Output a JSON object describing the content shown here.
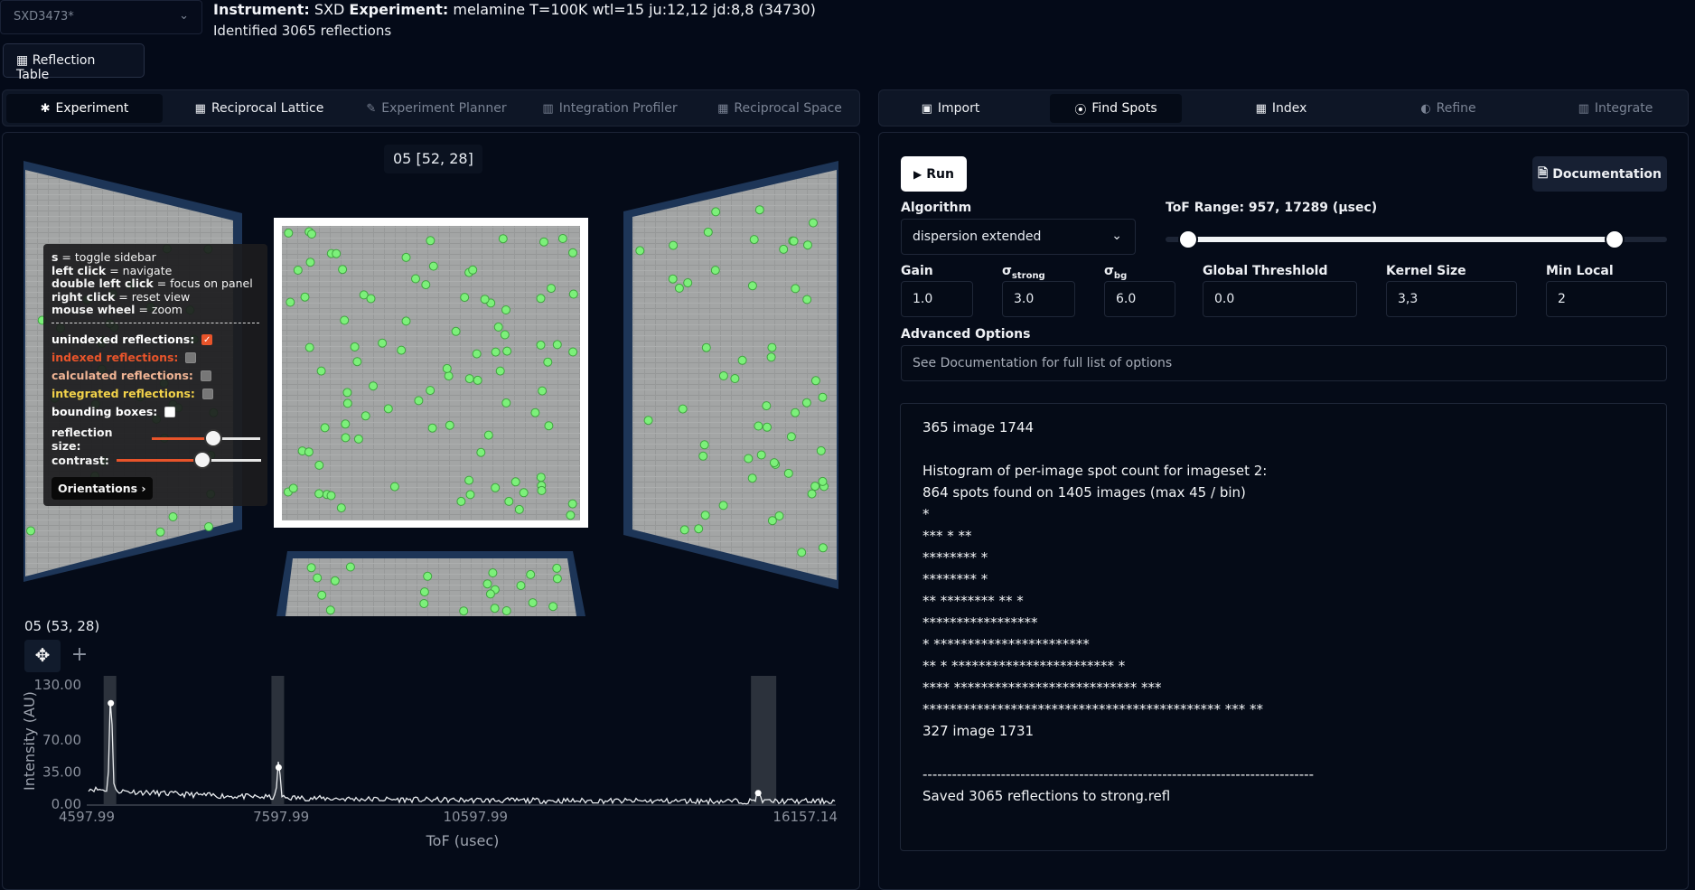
{
  "header": {
    "file_name": "SXD3473*",
    "instrument_label": "Instrument:",
    "instrument_value": "SXD",
    "experiment_label": "Experiment:",
    "experiment_value": "melamine T=100K wtl=15 ju:12,12 jd:8,8 (34730)",
    "status": "Identified 3065 reflections",
    "reflection_table_label": "Reflection Table"
  },
  "left_tabs": [
    {
      "label": "Experiment",
      "icon": "asterisk-icon",
      "active": true
    },
    {
      "label": "Reciprocal Lattice",
      "icon": "grid-icon",
      "active": false
    },
    {
      "label": "Experiment Planner",
      "icon": "pencil-icon",
      "active": false
    },
    {
      "label": "Integration Profiler",
      "icon": "chart-icon",
      "active": false
    },
    {
      "label": "Reciprocal Space",
      "icon": "grid-icon",
      "active": false
    }
  ],
  "right_tabs": [
    {
      "label": "Import",
      "icon": "image-icon",
      "active": false
    },
    {
      "label": "Find Spots",
      "icon": "target-icon",
      "active": true
    },
    {
      "label": "Index",
      "icon": "grid-icon",
      "active": false
    },
    {
      "label": "Refine",
      "icon": "half-circle-icon",
      "active": false
    },
    {
      "label": "Integrate",
      "icon": "chart-icon",
      "active": false
    }
  ],
  "viewer": {
    "hover_panel_label": "05 [52, 28]",
    "help": [
      {
        "key": "s",
        "text": " = toggle sidebar"
      },
      {
        "key": "left click",
        "text": " = navigate"
      },
      {
        "key": "double left click",
        "text": " = focus on panel"
      },
      {
        "key": "right click",
        "text": " = reset view"
      },
      {
        "key": "mouse wheel",
        "text": " = zoom"
      }
    ],
    "options": [
      {
        "label": "unindexed reflections:",
        "color": "#ffffff",
        "checked": true
      },
      {
        "label": "indexed reflections:",
        "color": "#e8542a",
        "checked": false
      },
      {
        "label": "calculated reflections:",
        "color": "#f0b494",
        "checked": false
      },
      {
        "label": "integrated reflections:",
        "color": "#f2d24a",
        "checked": false
      },
      {
        "label": "bounding boxes:",
        "color": "#ffffff",
        "checked": false
      }
    ],
    "reflection_size_label": "reflection size:",
    "reflection_size": 0.6,
    "contrast_label": "contrast:",
    "contrast": 0.6,
    "orientations_label": "Orientations"
  },
  "profile": {
    "title": "05 (53, 28)",
    "chart_data": {
      "type": "line",
      "xlabel": "ToF (usec)",
      "ylabel": "Intensity (AU)",
      "x_ticks": [
        "4597.99",
        "7597.99",
        "10597.99",
        "16157.14"
      ],
      "y_ticks": [
        "130.00",
        "70.00",
        "35.00",
        "0.00"
      ],
      "xlim": [
        4597.99,
        16157.14
      ],
      "ylim": [
        0,
        130
      ],
      "peaks": [
        {
          "x": 4970,
          "y": 112
        },
        {
          "x": 7560,
          "y": 42
        },
        {
          "x": 14960,
          "y": 14
        }
      ]
    }
  },
  "find_spots": {
    "run_label": "Run",
    "documentation_label": "Documentation",
    "algorithm_label": "Algorithm",
    "algorithm_value": "dispersion extended",
    "tof_range_label": "ToF Range: 957, 17289 (µsec)",
    "tof_range": {
      "min": 957,
      "max": 17289
    },
    "params": [
      {
        "label": "Gain",
        "sub": "",
        "value": "1.0"
      },
      {
        "label": "σ",
        "sub": "strong",
        "value": "3.0"
      },
      {
        "label": "σ",
        "sub": "bg",
        "value": "6.0"
      },
      {
        "label": "Global Threshlold",
        "sub": "",
        "value": "0.0"
      },
      {
        "label": "Kernel Size",
        "sub": "",
        "value": "3,3"
      },
      {
        "label": "Min Local",
        "sub": "",
        "value": "2"
      }
    ],
    "advanced_label": "Advanced Options",
    "advanced_placeholder": "See Documentation for full list of options",
    "log_lines": [
      "365 image 1744",
      "",
      "Histogram of per-image spot count for imageset 2:",
      "864 spots found on 1405 images (max 45 / bin)",
      "*",
      "*** * **",
      "******** *",
      "******** *",
      "** ******** ** *",
      "*****************",
      "* ***********************",
      "** * ************************ *",
      "**** *************************** ***",
      "******************************************** *** **",
      "327 image 1731",
      "",
      "--------------------------------------------------------------------------------",
      "Saved 3065 reflections to strong.refl"
    ]
  }
}
